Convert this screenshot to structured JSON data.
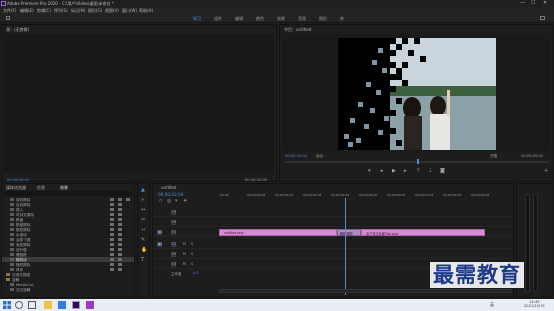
{
  "window": {
    "title": "Adobe Premiere Pro 2020 - C:\\用户\\Video\\桌面\\未命名 *",
    "controls": [
      "—",
      "☐",
      "✕"
    ]
  },
  "menu": [
    "文件(F)",
    "编辑(E)",
    "剪辑(C)",
    "序列(S)",
    "标记(M)",
    "图形(G)",
    "视图(V)",
    "窗口(W)",
    "帮助(H)"
  ],
  "workspaces": {
    "items": [
      "学习",
      "组件",
      "编辑",
      "颜色",
      "效果",
      "音频",
      "图形",
      "库"
    ],
    "active_index": 0
  },
  "source_monitor": {
    "tab": "源：(无剪辑)",
    "timecode_left": "00;00;00;00",
    "timecode_right": "00;00;00;00"
  },
  "program_monitor": {
    "tab": "节目：untitled",
    "timecode": "00;00;02;04",
    "fit": "适合",
    "quality": "完整",
    "duration": "00;00;05;00"
  },
  "effects_panel": {
    "tabs": [
      "媒体浏览器",
      "信息",
      "效果"
    ],
    "items": [
      "带状擦除",
      "径向擦除",
      "插入",
      "时钟式擦除",
      "棋盘",
      "棋盘擦除",
      "楔形擦除",
      "水波块",
      "油漆飞溅",
      "渐变擦除",
      "百叶窗",
      "螺旋框",
      "随机块",
      "随机擦除",
      "风车",
      "沉浸式视频",
      "溶解",
      "MorphCut",
      "交叉溶解"
    ],
    "selected_index": 12
  },
  "timeline": {
    "tab": "untitled",
    "timecode": "00;00;02;04",
    "ruler": [
      ":00;00",
      "00;00;00;16",
      "00;00;01;02",
      "00;00;01;18",
      "00;00;02;04",
      "00;00;02;20",
      "00;00;03;06",
      "00;00;03;22",
      "00;00;04;08",
      "00;00;04;24"
    ],
    "video_tracks": [
      "V3",
      "V2",
      "V1"
    ],
    "audio_tracks": [
      "A1",
      "A2",
      "A3"
    ],
    "master_label": "主声道",
    "master_value": "0.0",
    "clip_a": "untitled.png",
    "transition": "随机擦除",
    "clip_b": "由于是正反面Tbk.png",
    "playhead_position": 0.43
  },
  "watermark": "最需教育",
  "taskbar": {
    "time": "15:45",
    "date": "2021/10/15",
    "lang": "英"
  }
}
